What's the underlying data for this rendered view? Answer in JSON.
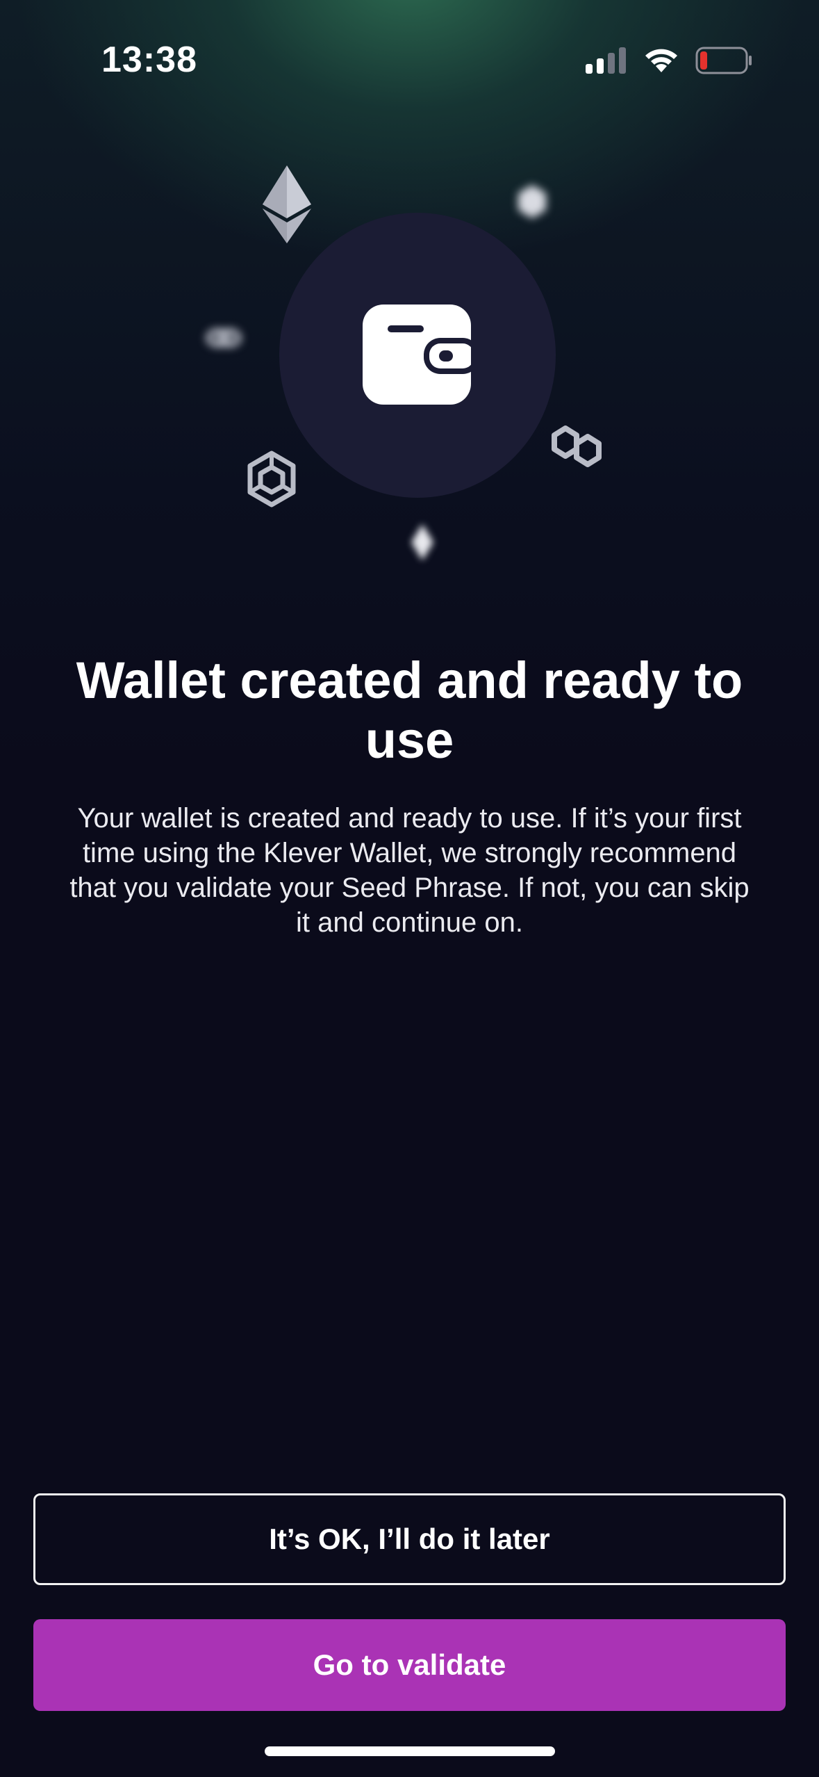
{
  "status_bar": {
    "time": "13:38",
    "icons": [
      "signal-icon",
      "wifi-icon",
      "battery-icon"
    ],
    "battery_level_color": "#e5322d"
  },
  "hero": {
    "icons": [
      "wallet-icon",
      "ethereum-icon",
      "polygon-icon",
      "bnb-icon"
    ]
  },
  "content": {
    "title": "Wallet created and ready to use",
    "description": "Your wallet is created and ready to use. If it’s your first time using the Klever Wallet, we strongly recommend that you validate your Seed Phrase. If not, you can skip it and continue on."
  },
  "actions": {
    "later_label": "It’s OK, I’ll do it later",
    "validate_label": "Go to validate"
  },
  "colors": {
    "background": "#0b0b1b",
    "accent": "#aa33b5",
    "hero_circle": "#1b1c34"
  }
}
